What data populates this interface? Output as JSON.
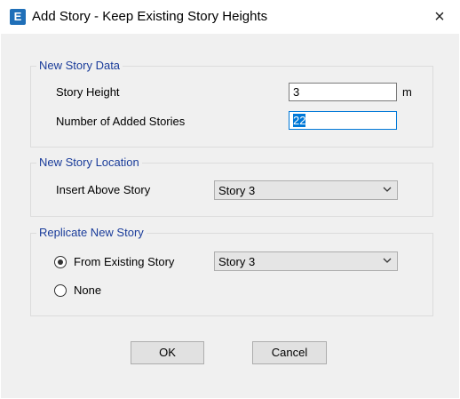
{
  "window": {
    "app_icon_letter": "E",
    "title": "Add Story - Keep Existing Story Heights",
    "close_symbol": "×"
  },
  "new_story_data": {
    "legend": "New Story Data",
    "story_height_label": "Story Height",
    "story_height_value": "3",
    "story_height_unit": "m",
    "added_stories_label": "Number of Added Stories",
    "added_stories_value": "22"
  },
  "new_story_location": {
    "legend": "New Story Location",
    "insert_above_label": "Insert Above Story",
    "insert_above_value": "Story 3"
  },
  "replicate": {
    "legend": "Replicate New Story",
    "from_existing_label": "From Existing Story",
    "from_existing_value": "Story 3",
    "none_label": "None",
    "selected": "from_existing"
  },
  "buttons": {
    "ok": "OK",
    "cancel": "Cancel"
  },
  "colors": {
    "legend_text": "#1a3c9a",
    "app_icon": "#1f6fb8",
    "dialog_bg": "#f0f0f0",
    "focus": "#0078d7"
  },
  "icons": {
    "app": "etabs-app-icon",
    "close": "close-icon",
    "dropdown": "chevron-down-icon"
  }
}
